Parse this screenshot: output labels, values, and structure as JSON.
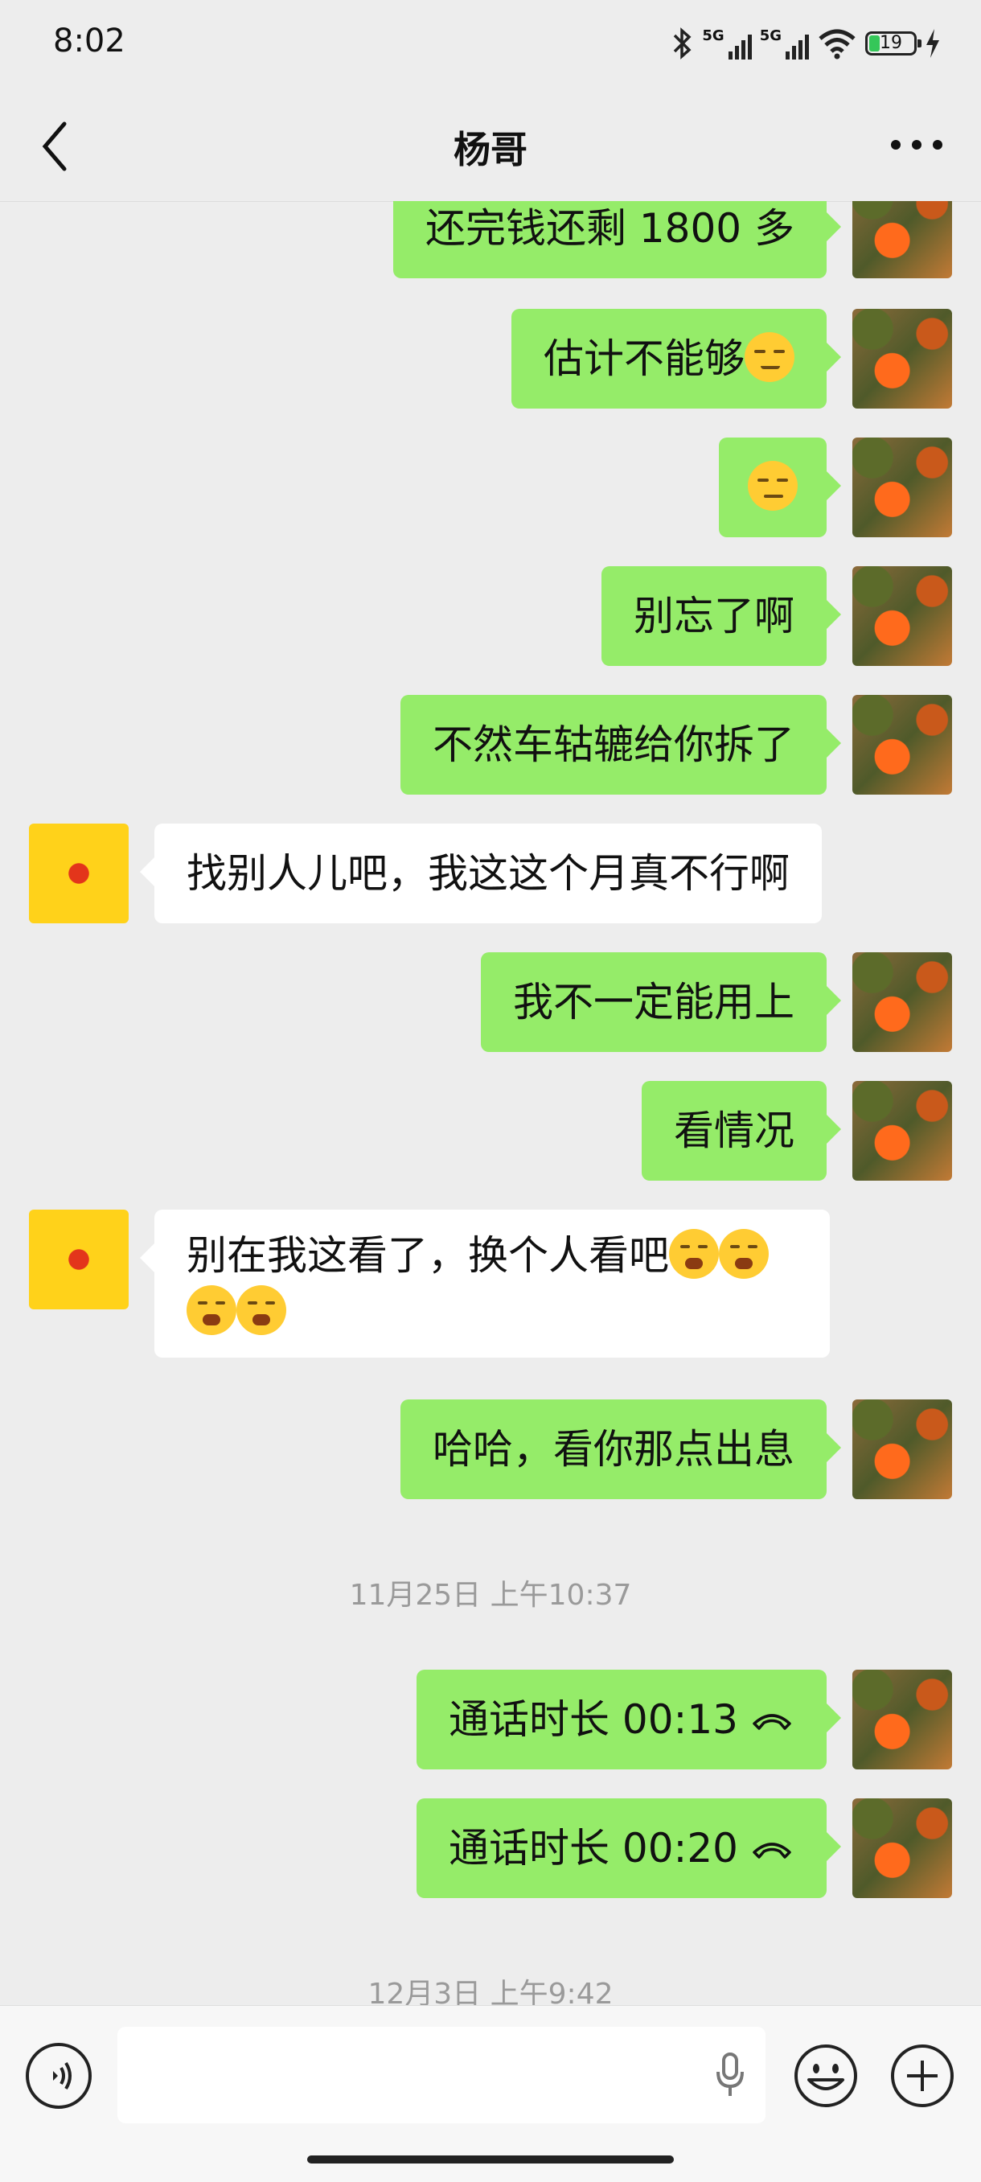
{
  "status_bar": {
    "time": "8:02",
    "network_1": "5G",
    "network_2": "5G",
    "battery": "19"
  },
  "header": {
    "title": "杨哥"
  },
  "messages": {
    "m1": "还完钱还剩 1800 多",
    "m2": "估计不能够",
    "m4": "别忘了啊",
    "m5": "不然车轱辘给你拆了",
    "m6": "找别人儿吧，我这这个月真不行啊",
    "m7": "我不一定能用上",
    "m8": "看情况",
    "m9": "别在我这看了，换个人看吧",
    "m10": "哈哈，看你那点出息",
    "ts1": "11月25日 上午10:37",
    "call1": "通话时长 00:13",
    "call2": "通话时长 00:20",
    "ts2": "12月3日 上午9:42"
  },
  "colors": {
    "outgoing_bubble": "#95ec69",
    "incoming_bubble": "#ffffff",
    "background": "#ededed"
  },
  "icons": [
    "bluetooth-icon",
    "signal-icon",
    "wifi-icon",
    "battery-icon",
    "charging-icon",
    "back-icon",
    "more-icon",
    "smirk-emoji-icon",
    "crying-emoji-icon",
    "hangup-icon",
    "voice-icon",
    "mic-icon",
    "emoji-icon",
    "plus-icon"
  ]
}
